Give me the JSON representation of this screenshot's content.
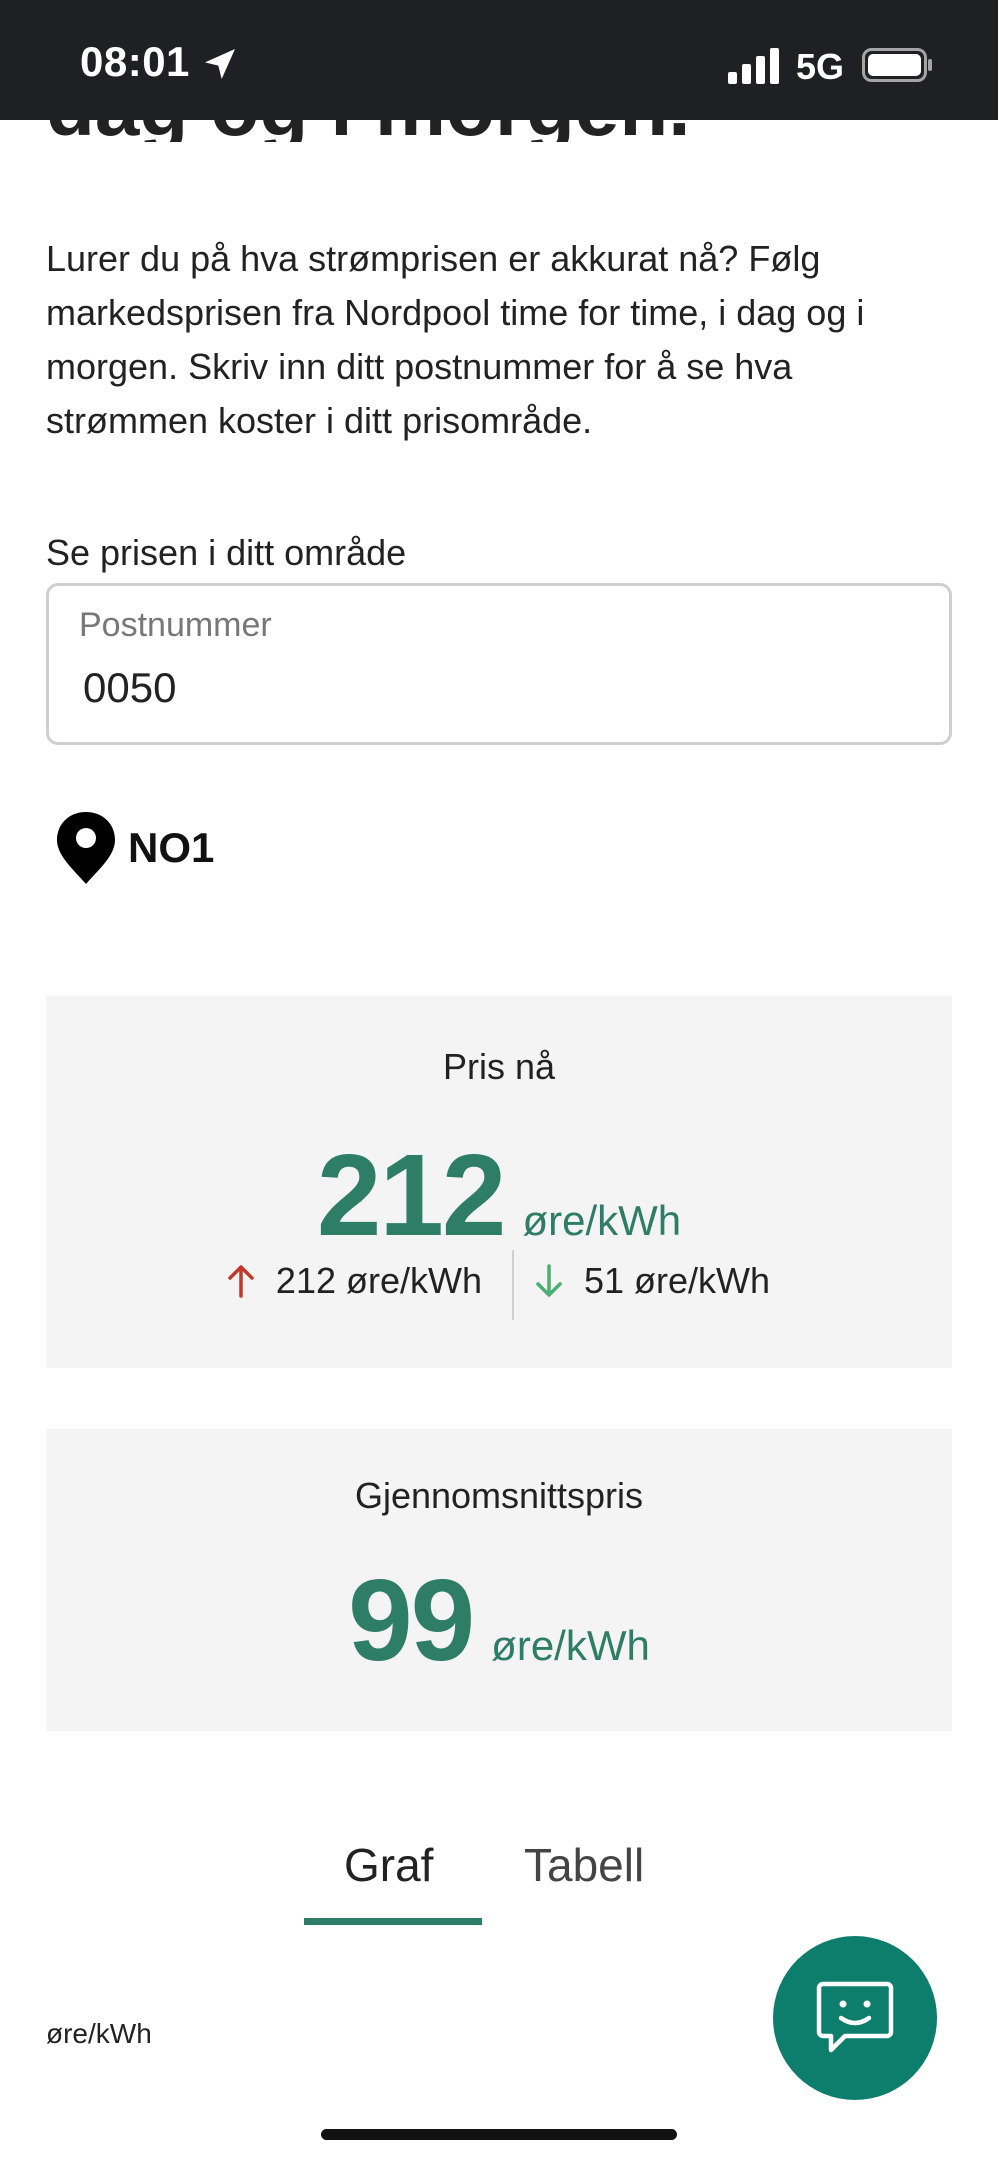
{
  "status_bar": {
    "time": "08:01",
    "network": "5G",
    "icons": [
      "location-arrow-icon",
      "signal-bars-icon",
      "battery-icon"
    ]
  },
  "page": {
    "heading_partial": "dag og i morgen."
  },
  "intro": {
    "text": "Lurer du på hva strømprisen er akkurat nå? Følg markedsprisen fra Nordpool time for time, i dag og i morgen. Skriv inn ditt postnummer for å se hva strømmen koster i ditt prisområde."
  },
  "postcode": {
    "label": "Se prisen i ditt område",
    "placeholder": "Postnummer",
    "value": "0050"
  },
  "area": {
    "name": "NO1",
    "icon": "map-pin-icon"
  },
  "price_now": {
    "title": "Pris nå",
    "value": "212",
    "unit": "øre/kWh",
    "max_value": "212 øre/kWh",
    "min_value": "51 øre/kWh",
    "max_color": "#c0392b",
    "min_color": "#4caf72"
  },
  "average_price": {
    "title": "Gjennomsnittspris",
    "value": "99",
    "unit": "øre/kWh"
  },
  "tabs": [
    {
      "label": "Graf",
      "active": true
    },
    {
      "label": "Tabell",
      "active": false
    }
  ],
  "chart": {
    "unit_label": "øre/kWh"
  },
  "chat": {
    "icon": "chat-smiley-icon"
  },
  "colors": {
    "accent": "#2e7d66",
    "fab": "#0d7d6c",
    "card_bg": "#f4f4f4"
  }
}
